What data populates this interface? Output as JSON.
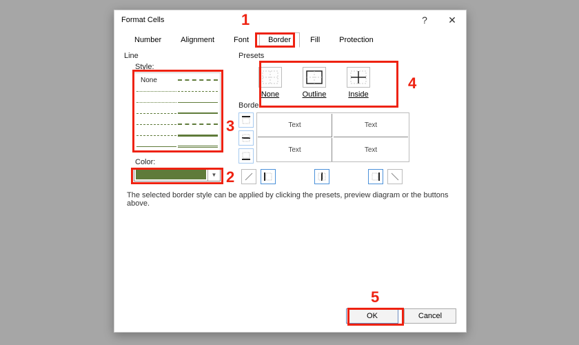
{
  "dialog": {
    "title": "Format Cells",
    "help_icon": "?",
    "close_icon": "✕"
  },
  "tabs": [
    "Number",
    "Alignment",
    "Font",
    "Border",
    "Fill",
    "Protection"
  ],
  "active_tab": "Border",
  "line": {
    "group_label": "Line",
    "style_label": "Style:",
    "none_label": "None",
    "color_label": "Color:",
    "color_value": "#5f7b3a"
  },
  "presets": {
    "group_label": "Presets",
    "items": [
      {
        "label": "None"
      },
      {
        "label": "Outline"
      },
      {
        "label": "Inside"
      }
    ]
  },
  "border_section": {
    "group_label": "Border",
    "preview_cells": [
      "Text",
      "Text",
      "Text",
      "Text"
    ]
  },
  "help_text": "The selected border style can be applied by clicking the presets, preview diagram or the buttons above.",
  "buttons": {
    "ok": "OK",
    "cancel": "Cancel"
  },
  "annotations": {
    "n1": "1",
    "n2": "2",
    "n3": "3",
    "n4": "4",
    "n5": "5"
  }
}
